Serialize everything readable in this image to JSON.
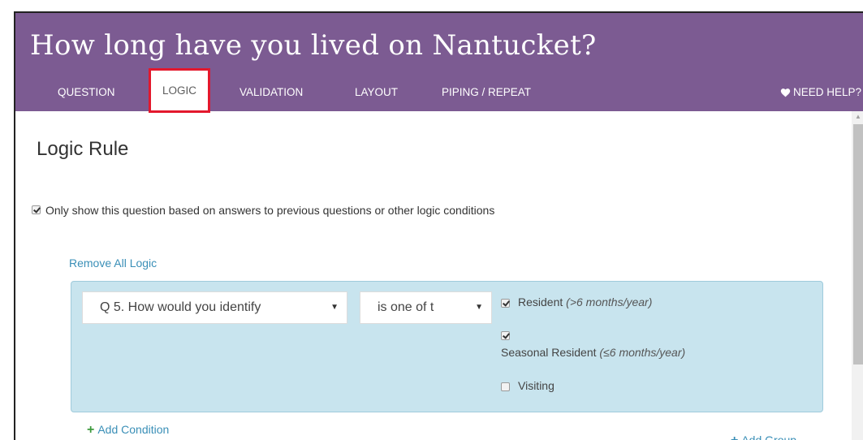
{
  "header": {
    "title": "How long have you lived on Nantucket?",
    "tabs": [
      {
        "label": "QUESTION"
      },
      {
        "label": "LOGIC",
        "active": true
      },
      {
        "label": "VALIDATION"
      },
      {
        "label": "LAYOUT"
      },
      {
        "label": "PIPING / REPEAT"
      }
    ],
    "help_label": "NEED HELP?",
    "help_icon": "heart-icon"
  },
  "logic": {
    "heading": "Logic Rule",
    "enable_checked": true,
    "enable_label": "Only show this question based on answers to previous questions or other logic conditions",
    "remove_all": "Remove All Logic",
    "condition": {
      "question_select": "Q 5. How would you identify",
      "operator_select": "is one of t",
      "options": [
        {
          "label": "Resident",
          "note": "(>6 months/year)",
          "checked": true
        },
        {
          "label": "Seasonal Resident",
          "note": "(≤6 months/year)",
          "checked": true
        },
        {
          "label": "Visiting",
          "note": "",
          "checked": false
        }
      ]
    },
    "add_condition": "Add Condition",
    "add_group": "Add Group"
  },
  "colors": {
    "header_bg": "#7c5b92",
    "active_tab_border": "#e3182d",
    "link": "#3a8fb7",
    "condition_bg": "#c8e4ee",
    "add_condition_plus": "#3d9a3d"
  }
}
